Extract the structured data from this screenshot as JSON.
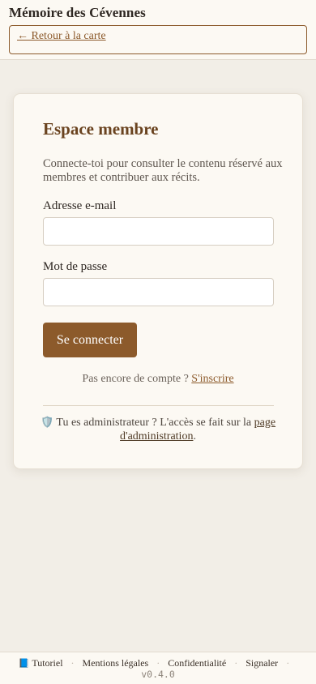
{
  "header": {
    "title": "Mémoire des Cévennes",
    "back_link": "← Retour à la carte"
  },
  "login": {
    "title": "Espace membre",
    "intro": "Connecte-toi pour consulter le contenu réservé aux membres et contribuer aux récits.",
    "email_label": "Adresse e-mail",
    "email_value": "",
    "password_label": "Mot de passe",
    "password_value": "",
    "submit_label": "Se connecter",
    "signup_text": "Pas encore de compte ?",
    "signup_link": "S'inscrire",
    "admin_icon": "🛡️",
    "admin_text": "Tu es administrateur ? L'accès se fait sur la",
    "admin_link": "page d'administration",
    "admin_suffix": "."
  },
  "footer": {
    "tutorial_icon": "📘",
    "tutorial": "Tutoriel",
    "legal": "Mentions légales",
    "privacy": "Confidentialité",
    "report": "Signaler",
    "separator": "·",
    "version": "v0.4.0"
  },
  "colors": {
    "accent": "#8c5a2b",
    "background": "#f2eee7",
    "card": "#fcf9f3"
  }
}
